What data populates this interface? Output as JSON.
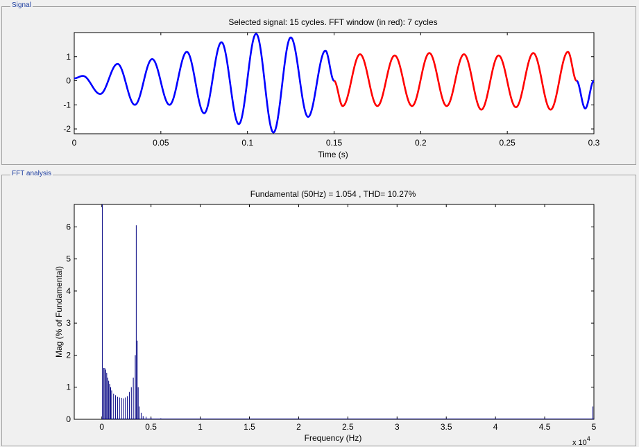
{
  "groups": {
    "signal_title": "Signal",
    "fft_title": "FFT analysis"
  },
  "colors": {
    "signal_line": "#0000ff",
    "fft_window": "#ff0000",
    "spectrum_bar": "#000080",
    "group_title": "#1f3fa0"
  },
  "chart_data": [
    {
      "type": "line",
      "title": "Selected signal: 15 cycles. FFT window (in red): 7 cycles",
      "xlabel": "Time (s)",
      "ylabel": "",
      "xlim": [
        0,
        0.3
      ],
      "ylim": [
        -2.2,
        2.0
      ],
      "xticks": [
        0,
        0.05,
        0.1,
        0.15,
        0.2,
        0.25,
        0.3
      ],
      "xtick_labels": [
        "0",
        "0.05",
        "0.1",
        "0.15",
        "0.2",
        "0.25",
        "0.3"
      ],
      "yticks": [
        -2,
        -1,
        0,
        1
      ],
      "ytick_labels": [
        "-2",
        "-1",
        "0",
        "1"
      ],
      "frequency_hz": 50,
      "fft_window_s": [
        0.15,
        0.29
      ],
      "series": [
        {
          "color": "#0000ff",
          "x": [
            0,
            0.005,
            0.015,
            0.025,
            0.035,
            0.045,
            0.055,
            0.065,
            0.075,
            0.085,
            0.095,
            0.105,
            0.115,
            0.125,
            0.135,
            0.145,
            0.15
          ],
          "y": [
            0.1,
            0.2,
            -0.55,
            0.7,
            -1.0,
            0.9,
            -1.0,
            1.2,
            -1.35,
            1.6,
            -1.8,
            1.95,
            -2.15,
            1.8,
            -1.5,
            1.25,
            0.0
          ]
        },
        {
          "color": "#ff0000",
          "x": [
            0.15,
            0.155,
            0.165,
            0.175,
            0.185,
            0.195,
            0.205,
            0.215,
            0.225,
            0.235,
            0.245,
            0.255,
            0.265,
            0.275,
            0.285,
            0.29
          ],
          "y": [
            0.0,
            -1.05,
            1.1,
            -1.05,
            1.05,
            -1.05,
            1.15,
            -1.05,
            1.1,
            -1.2,
            1.05,
            -1.1,
            1.15,
            -1.2,
            1.2,
            0.0
          ]
        },
        {
          "color": "#0000ff",
          "x": [
            0.29,
            0.295,
            0.3
          ],
          "y": [
            0.0,
            -1.15,
            0.0
          ]
        }
      ]
    },
    {
      "type": "bar",
      "title": "Fundamental (50Hz) = 1.054 , THD= 10.27%",
      "xlabel": "Frequency (Hz)",
      "ylabel": "Mag (% of Fundamental)",
      "x_multiplier": "x 10",
      "x_multiplier_exp": "4",
      "xlim": [
        -0.28,
        5.0
      ],
      "ylim": [
        0,
        6.7
      ],
      "xticks": [
        0,
        0.5,
        1,
        1.5,
        2,
        2.5,
        3,
        3.5,
        4,
        4.5,
        5
      ],
      "xtick_labels": [
        "0",
        "0.5",
        "1",
        "1.5",
        "2",
        "2.5",
        "3",
        "3.5",
        "4",
        "4.5",
        "5"
      ],
      "yticks": [
        0,
        1,
        2,
        3,
        4,
        5,
        6
      ],
      "ytick_labels": [
        "0",
        "1",
        "2",
        "3",
        "4",
        "5",
        "6"
      ],
      "bars": {
        "x": [
          0.005,
          0.02,
          0.03,
          0.04,
          0.05,
          0.06,
          0.07,
          0.08,
          0.09,
          0.1,
          0.12,
          0.14,
          0.16,
          0.18,
          0.2,
          0.22,
          0.24,
          0.26,
          0.28,
          0.3,
          0.32,
          0.34,
          0.35,
          0.36,
          0.37,
          0.38,
          0.4,
          0.42,
          0.45,
          0.5,
          0.6,
          0.7,
          4.99
        ],
        "y": [
          6.7,
          1.6,
          1.6,
          1.55,
          1.45,
          1.3,
          1.2,
          1.1,
          1.0,
          0.9,
          0.8,
          0.75,
          0.7,
          0.68,
          0.67,
          0.65,
          0.68,
          0.72,
          0.85,
          1.0,
          1.3,
          2.0,
          6.05,
          2.45,
          1.0,
          0.4,
          0.2,
          0.1,
          0.08,
          0.05,
          0.03,
          0.02,
          0.4
        ]
      }
    }
  ]
}
